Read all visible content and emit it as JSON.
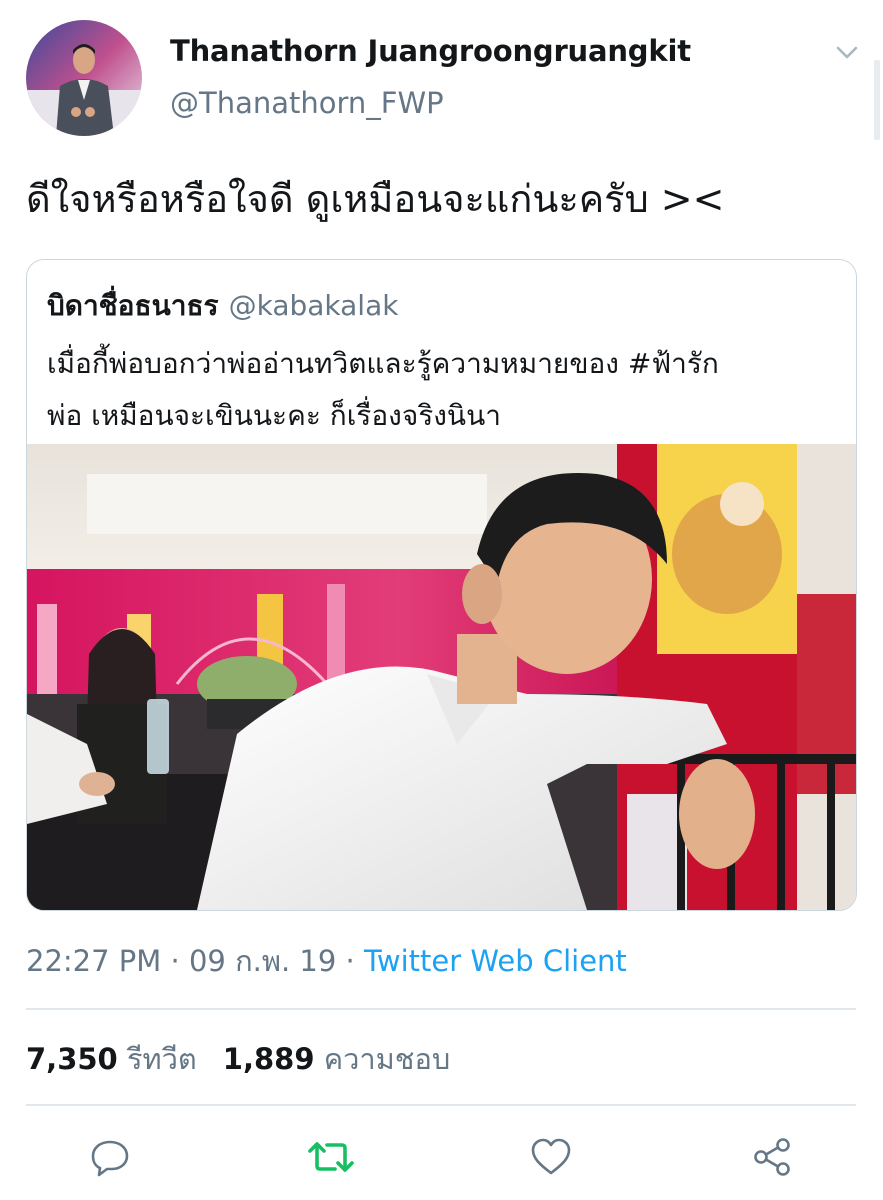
{
  "tweet": {
    "author_name": "Thanathorn Juangroongruangkit",
    "author_handle": "@Thanathorn_FWP",
    "text": "ดีใจหรือหรือใจดี ดูเหมือนจะแก่นะครับ ><"
  },
  "quoted_tweet": {
    "author_name": "บิดาชื่อธนาธร",
    "author_handle": "@kabakalak",
    "text_line_1": "เมื่อกี้พ่อบอกว่าพ่ออ่านทวิตและรู้ความหมายของ #ฟ้ารัก",
    "text_line_2": "พ่อ เหมือนจะเขินนะคะ ก็เรื่องจริงนินา"
  },
  "meta": {
    "time": "22:27 PM",
    "separator": "·",
    "date": "09 ก.พ. 19",
    "client": "Twitter Web Client"
  },
  "stats": {
    "retweets_count": "7,350",
    "retweets_label": "รีทวีต",
    "likes_count": "1,889",
    "likes_label": "ความชอบ"
  },
  "colors": {
    "link": "#1da1f2",
    "retweet_active": "#17bf63",
    "secondary_text": "#657786"
  },
  "icons": {
    "caret": "chevron-down-icon",
    "reply": "reply-icon",
    "retweet": "retweet-icon",
    "like": "heart-icon",
    "share": "share-icon"
  }
}
